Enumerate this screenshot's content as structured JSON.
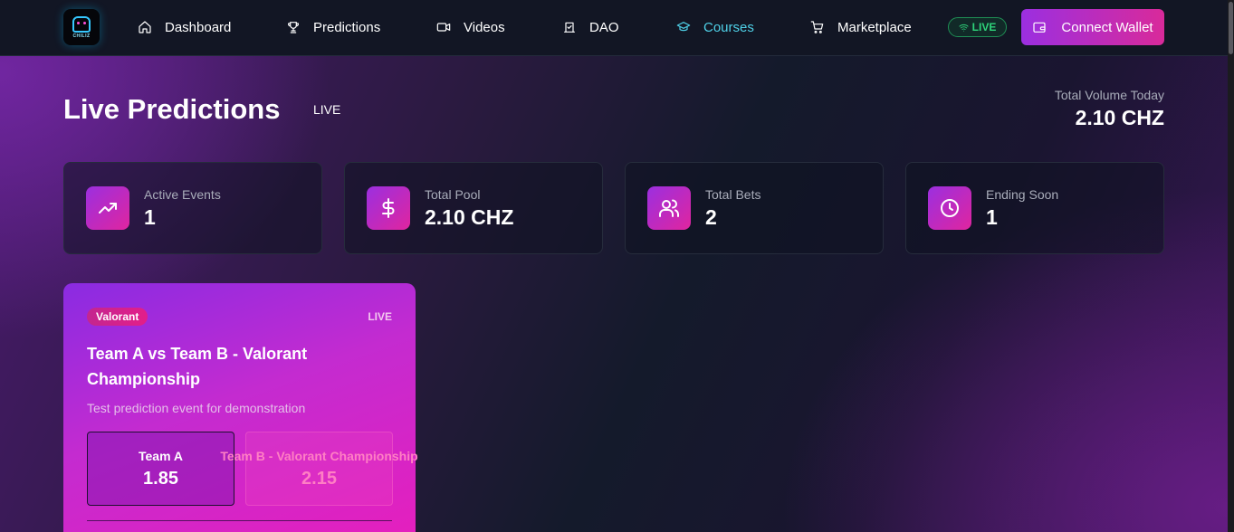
{
  "nav": {
    "logo_text": "CHILIZ",
    "items": [
      {
        "label": "Dashboard",
        "icon": "home-icon"
      },
      {
        "label": "Predictions",
        "icon": "trophy-icon"
      },
      {
        "label": "Videos",
        "icon": "video-icon"
      },
      {
        "label": "DAO",
        "icon": "vote-icon"
      },
      {
        "label": "Courses",
        "icon": "graduation-cap-icon",
        "active": true
      },
      {
        "label": "Marketplace",
        "icon": "cart-icon"
      }
    ],
    "live_badge": "LIVE",
    "connect_label": "Connect Wallet"
  },
  "header": {
    "title": "Live Predictions",
    "live_label": "LIVE",
    "volume_label": "Total Volume Today",
    "volume_value": "2.10 CHZ"
  },
  "stats": [
    {
      "label": "Active Events",
      "value": "1",
      "icon": "trending-up-icon"
    },
    {
      "label": "Total Pool",
      "value": "2.10 CHZ",
      "icon": "dollar-icon"
    },
    {
      "label": "Total Bets",
      "value": "2",
      "icon": "users-icon"
    },
    {
      "label": "Ending Soon",
      "value": "1",
      "icon": "clock-icon"
    }
  ],
  "event": {
    "tag": "Valorant",
    "status": "LIVE",
    "title": "Team A vs Team B - Valorant Championship",
    "description": "Test prediction event for demonstration",
    "options": [
      {
        "name": "Team A",
        "odds": "1.85"
      },
      {
        "name": "Team B - Valorant Championship",
        "odds": "2.15"
      }
    ]
  },
  "colors": {
    "accent_purple": "#9b2fe0",
    "accent_pink": "#e0259f",
    "active_nav": "#4fd1e8",
    "live_green": "#2ed47a"
  }
}
